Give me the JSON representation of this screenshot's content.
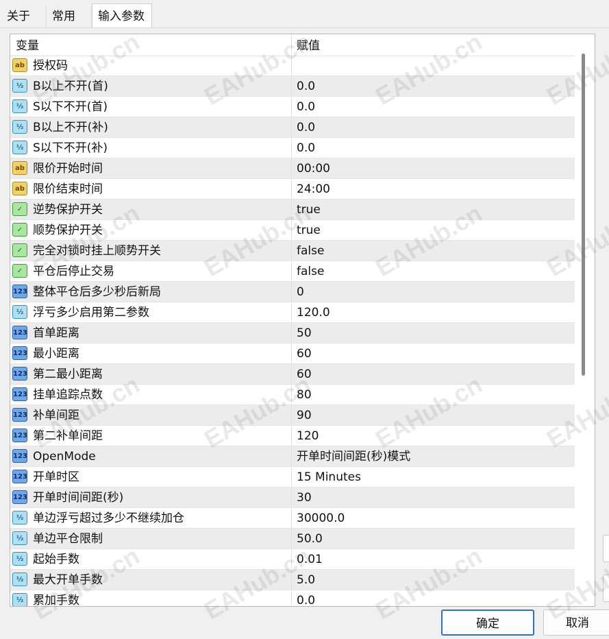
{
  "tabs": [
    "关于",
    "常用",
    "输入参数"
  ],
  "table": {
    "headers": {
      "variable": "变量",
      "value": "赋值"
    },
    "rows": [
      {
        "type": "string",
        "name": "授权码",
        "value": ""
      },
      {
        "type": "double",
        "name": "B以上不开(首)",
        "value": "0.0"
      },
      {
        "type": "double",
        "name": "S以下不开(首)",
        "value": "0.0"
      },
      {
        "type": "double",
        "name": "B以上不开(补)",
        "value": "0.0"
      },
      {
        "type": "double",
        "name": "S以下不开(补)",
        "value": "0.0"
      },
      {
        "type": "string",
        "name": "限价开始时间",
        "value": "00:00"
      },
      {
        "type": "string",
        "name": "限价结束时间",
        "value": "24:00"
      },
      {
        "type": "bool",
        "name": "逆势保护开关",
        "value": "true"
      },
      {
        "type": "bool",
        "name": "顺势保护开关",
        "value": "true"
      },
      {
        "type": "bool",
        "name": "完全对锁时挂上顺势开关",
        "value": "false"
      },
      {
        "type": "bool",
        "name": "平仓后停止交易",
        "value": "false"
      },
      {
        "type": "int",
        "name": "整体平仓后多少秒后新局",
        "value": "0"
      },
      {
        "type": "double",
        "name": "浮亏多少启用第二参数",
        "value": "120.0"
      },
      {
        "type": "int",
        "name": "首单距离",
        "value": "50"
      },
      {
        "type": "int",
        "name": "最小距离",
        "value": "60"
      },
      {
        "type": "int",
        "name": "第二最小距离",
        "value": "60"
      },
      {
        "type": "int",
        "name": "挂单追踪点数",
        "value": "80"
      },
      {
        "type": "int",
        "name": "补单间距",
        "value": "90"
      },
      {
        "type": "int",
        "name": "第二补单间距",
        "value": "120"
      },
      {
        "type": "enum",
        "name": "OpenMode",
        "value": "开单时间间距(秒)模式"
      },
      {
        "type": "enum",
        "name": "开单时区",
        "value": "15 Minutes"
      },
      {
        "type": "int",
        "name": "开单时间间距(秒)",
        "value": "30"
      },
      {
        "type": "double",
        "name": "单边浮亏超过多少不继续加仓",
        "value": "30000.0"
      },
      {
        "type": "double",
        "name": "单边平仓限制",
        "value": "50.0"
      },
      {
        "type": "double",
        "name": "起始手数",
        "value": "0.01"
      },
      {
        "type": "double",
        "name": "最大开单手数",
        "value": "5.0"
      },
      {
        "type": "double",
        "name": "累加手数",
        "value": "0.0"
      }
    ]
  },
  "icon_labels": {
    "string": "ab",
    "double": "½",
    "bool": "✓",
    "int": "123",
    "enum": "123"
  },
  "buttons": {
    "ok": "确定",
    "cancel": "取消"
  },
  "watermark": "EAHub.cn"
}
